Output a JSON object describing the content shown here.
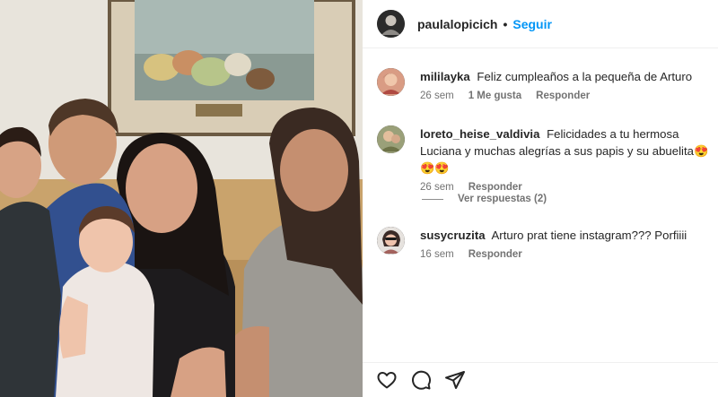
{
  "post": {
    "username": "paulalopicich",
    "separator": "•",
    "follow_label": "Seguir"
  },
  "comments": [
    {
      "username": "mililayka",
      "text": "Feliz cumpleaños a la pequeña de Arturo",
      "time": "26 sem",
      "likes": "1 Me gusta",
      "reply_label": "Responder"
    },
    {
      "username": "loreto_heise_valdivia",
      "text": "Felicidades a tu hermosa Luciana y muchas alegrías a sus papis y su abuelita😍😍😍",
      "time": "26 sem",
      "reply_label": "Responder"
    },
    {
      "username": "susycruzita",
      "text": "Arturo prat tiene instagram??? Porfiiii",
      "time": "16 sem",
      "reply_label": "Responder"
    }
  ],
  "view_replies_label": "Ver respuestas (2)",
  "icons": {
    "like": "heart-icon",
    "comment": "comment-icon",
    "share": "paper-plane-icon"
  },
  "colors": {
    "follow": "#0095f6",
    "meta": "#737373",
    "text": "#262626"
  }
}
